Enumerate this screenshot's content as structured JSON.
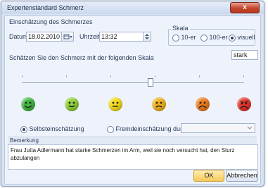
{
  "window": {
    "title": "Expertenstandard Schmerz",
    "close_symbol": "x"
  },
  "assessment": {
    "section_label": "Einschätzung des Schmerzes",
    "date_label": "Datum",
    "date_value": "18.02.2010",
    "time_label": "Uhrzeit",
    "time_value": "13:32"
  },
  "scale": {
    "group_label": "Skala",
    "options": [
      {
        "label": "10-er",
        "selected": false
      },
      {
        "label": "100-er",
        "selected": false
      },
      {
        "label": "visuell",
        "selected": true
      }
    ]
  },
  "rating": {
    "instruction": "Schätzen Sie den Schmerz mit der folgenden Skala",
    "value_label": "stark",
    "slider_fraction": 0.58,
    "faces": [
      {
        "name": "face-very-happy",
        "color": "#3fb83f"
      },
      {
        "name": "face-happy",
        "color": "#8fd13b"
      },
      {
        "name": "face-neutral",
        "color": "#f2dc1c"
      },
      {
        "name": "face-slightly-sad",
        "color": "#f0b21c"
      },
      {
        "name": "face-sad",
        "color": "#ee7a1c"
      },
      {
        "name": "face-very-sad",
        "color": "#e3332a"
      }
    ]
  },
  "assessment_type": {
    "self_label": "Selbsteinschätzung",
    "self_selected": true,
    "other_label": "Fremdeinschätzung durch",
    "other_selected": false,
    "other_dropdown_value": ""
  },
  "remarks": {
    "label": "Bemerkung",
    "text": "Frau Jutta Adlermann hat starke Schmerzen im Arm, weil sie noch versucht hat, den Sturz abzulangen"
  },
  "buttons": {
    "ok": "OK",
    "cancel": "Abbrechen"
  }
}
